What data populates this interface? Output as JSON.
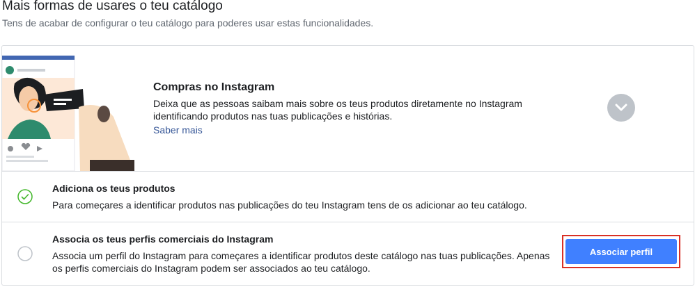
{
  "section": {
    "title": "Mais formas de usares o teu catálogo",
    "subtitle": "Tens de acabar de configurar o teu catálogo para poderes usar estas funcionalidades."
  },
  "feature": {
    "title": "Compras no Instagram",
    "description": "Deixa que as pessoas saibam mais sobre os teus produtos diretamente no Instagram identificando produtos nas tuas publicações e histórias.",
    "link": "Saber mais",
    "toggle_icon": "chevron-down-icon"
  },
  "steps": [
    {
      "title": "Adiciona os teus produtos",
      "description": "Para começares a identificar produtos nas publicações do teu Instagram tens de os adicionar ao teu catálogo.",
      "status": "complete",
      "icon": "check-circle-icon"
    },
    {
      "title": "Associa os teus perfis comerciais do Instagram",
      "description": "Associa um perfil do Instagram para começares a identificar produtos deste catálogo nas tuas publicações. Apenas os perfis comerciais do Instagram podem ser associados ao teu catálogo.",
      "status": "incomplete",
      "icon": "empty-circle-icon",
      "button": "Associar perfil"
    }
  ],
  "colors": {
    "accent": "#4080ff",
    "link": "#385898",
    "check": "#42b72a",
    "highlight_border": "#d93025"
  }
}
